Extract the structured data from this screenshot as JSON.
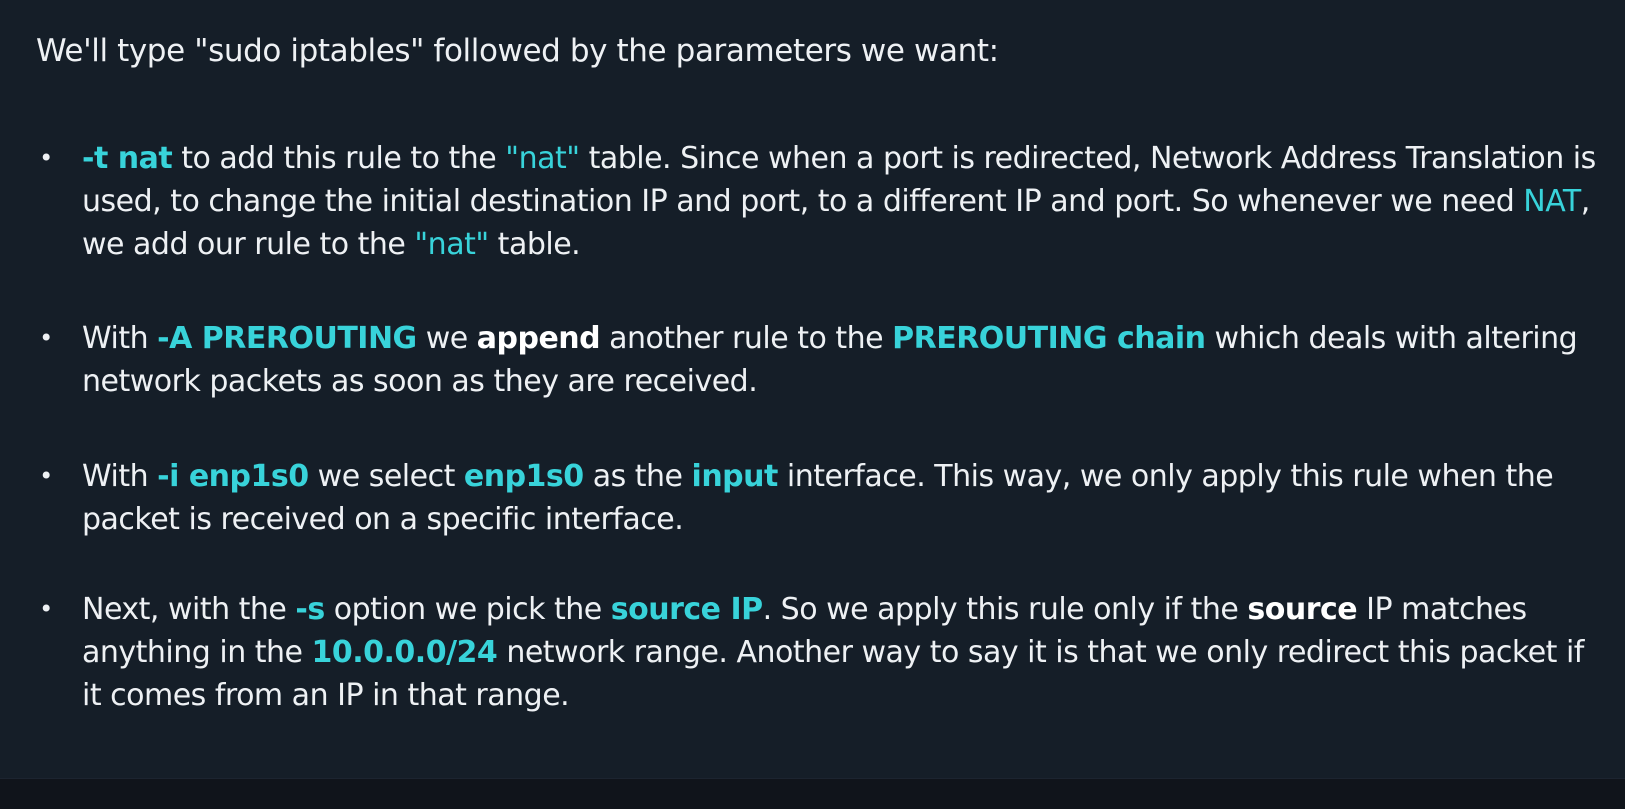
{
  "intro": "We'll type \"sudo iptables\" followed by the parameters we want:",
  "bullet_symbol": "•",
  "colors": {
    "background": "#151e28",
    "text": "#eef1f4",
    "highlight": "#38d3da"
  },
  "bullets": [
    {
      "segments": [
        "-t nat",
        " to add this rule to the ",
        "\"nat\"",
        " table. Since when a port is redirected, Network Address Translation is used, to change the initial destination IP and port, to a different IP and port. So whenever we need ",
        "NAT",
        ", we add our rule to the ",
        "\"nat\"",
        " table."
      ]
    },
    {
      "segments": [
        "With ",
        "-A PREROUTING",
        " we ",
        "append",
        " another rule to the ",
        "PREROUTING chain",
        " which deals with altering network packets as soon as they are received."
      ]
    },
    {
      "segments": [
        "With ",
        "-i enp1s0",
        " we select ",
        "enp1s0",
        " as the ",
        "input",
        " interface. This way, we only apply this rule when the packet is received on a specific interface."
      ]
    },
    {
      "segments": [
        "Next, with the ",
        "-s",
        " option we pick the ",
        "source IP",
        ". So we apply this rule only if the ",
        "source",
        " IP matches anything in the ",
        "10.0.0.0/24",
        " network range. Another way to say it is that we only redirect this packet if it comes from an IP in that range."
      ]
    }
  ]
}
